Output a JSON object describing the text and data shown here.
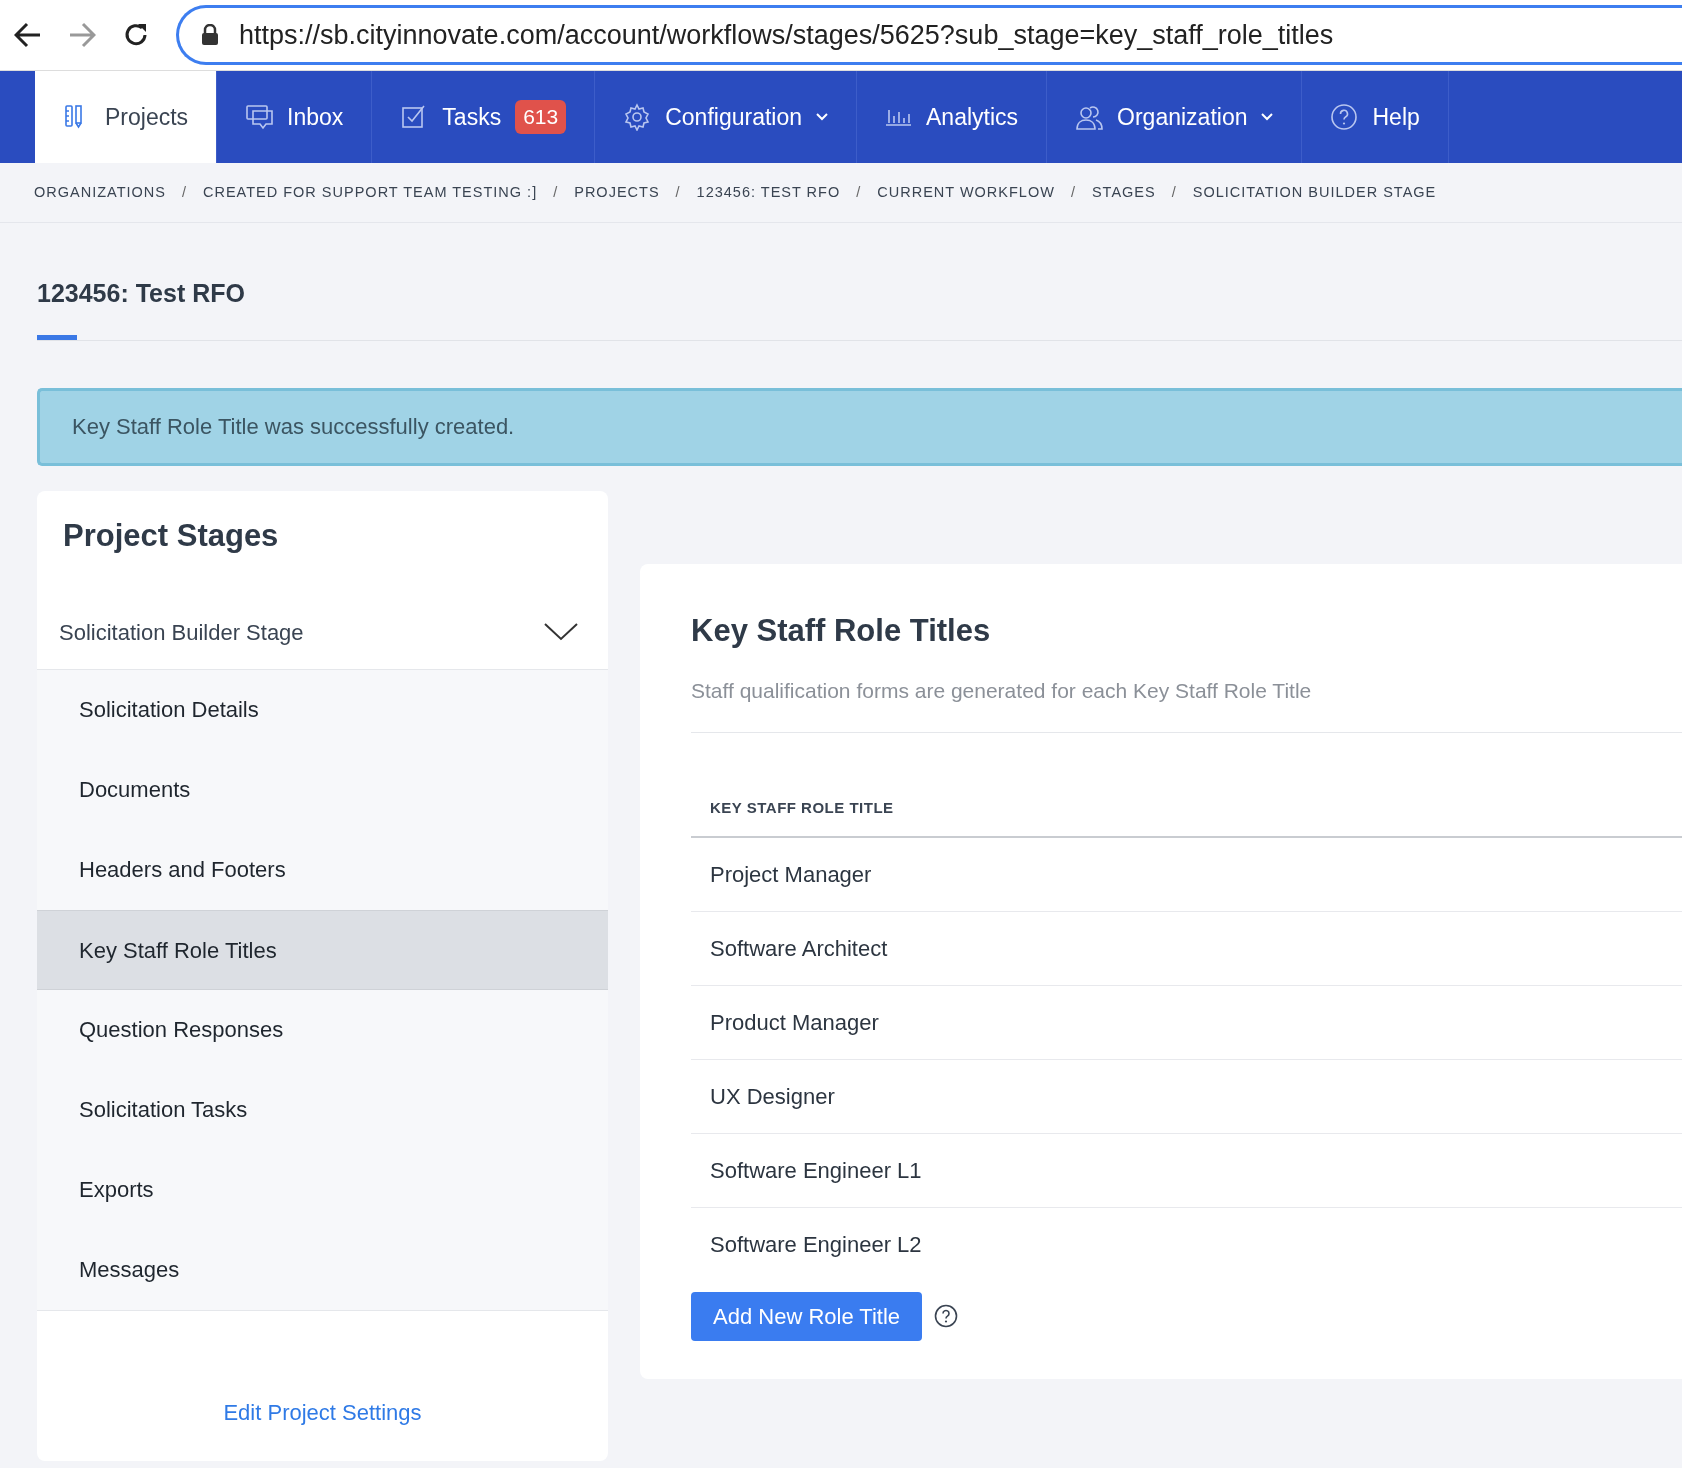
{
  "browser": {
    "url": "https://sb.cityinnovate.com/account/workflows/stages/5625?sub_stage=key_staff_role_titles"
  },
  "nav": [
    {
      "label": "Projects",
      "kind": "projects",
      "selected": true,
      "dropdown": false
    },
    {
      "label": "Inbox",
      "kind": "inbox",
      "selected": false,
      "dropdown": false
    },
    {
      "label": "Tasks",
      "kind": "tasks",
      "badge": "613",
      "selected": false,
      "dropdown": false
    },
    {
      "label": "Configuration",
      "kind": "gear",
      "selected": false,
      "dropdown": true
    },
    {
      "label": "Analytics",
      "kind": "analytics",
      "selected": false,
      "dropdown": false
    },
    {
      "label": "Organization",
      "kind": "users",
      "selected": false,
      "dropdown": true
    },
    {
      "label": "Help",
      "kind": "help",
      "selected": false,
      "dropdown": false
    }
  ],
  "breadcrumb_separator": "/",
  "breadcrumbs": [
    "ORGANIZATIONS",
    "CREATED FOR SUPPORT TEAM TESTING :]",
    "PROJECTS",
    "123456: TEST RFO",
    "CURRENT WORKFLOW",
    "STAGES",
    "SOLICITATION BUILDER STAGE"
  ],
  "page_title": "123456: Test RFO",
  "alert": "Key Staff Role Title was successfully created.",
  "sidebar": {
    "title": "Project Stages",
    "stage": {
      "label": "Solicitation Builder Stage",
      "expanded": true
    },
    "items": [
      {
        "label": "Solicitation Details",
        "selected": false
      },
      {
        "label": "Documents",
        "selected": false
      },
      {
        "label": "Headers and Footers",
        "selected": false
      },
      {
        "label": "Key Staff Role Titles",
        "selected": true
      },
      {
        "label": "Question Responses",
        "selected": false
      },
      {
        "label": "Solicitation Tasks",
        "selected": false
      },
      {
        "label": "Exports",
        "selected": false
      },
      {
        "label": "Messages",
        "selected": false
      }
    ],
    "footer_link": "Edit Project Settings"
  },
  "main": {
    "title": "Key Staff Role Titles",
    "subtitle": "Staff qualification forms are generated for each Key Staff Role Title",
    "table": {
      "columns": [
        "KEY STAFF ROLE TITLE"
      ],
      "rows": [
        [
          "Project Manager"
        ],
        [
          "Software Architect"
        ],
        [
          "Product Manager"
        ],
        [
          "UX Designer"
        ],
        [
          "Software Engineer L1"
        ],
        [
          "Software Engineer L2"
        ]
      ]
    },
    "button": "Add New Role Title"
  }
}
